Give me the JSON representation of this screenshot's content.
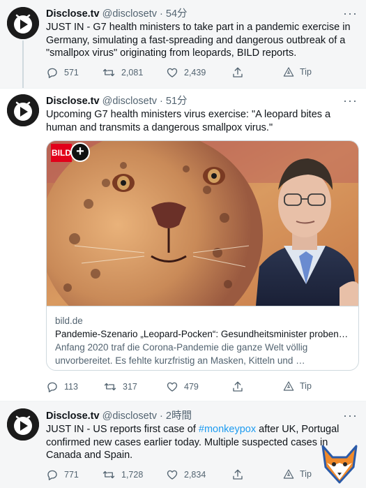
{
  "tweets": [
    {
      "name": "Disclose.tv",
      "handle": "@disclosetv",
      "time": "54分",
      "text": "JUST IN - G7 health ministers to take part in a pandemic exercise in Germany, simulating a fast-spreading and dangerous outbreak of a \"smallpox virus\" originating from leopards, BILD reports.",
      "replies": "571",
      "retweets": "2,081",
      "likes": "2,439",
      "tip": "Tip"
    },
    {
      "name": "Disclose.tv",
      "handle": "@disclosetv",
      "time": "51分",
      "text": "Upcoming G7 health ministers virus exercise: \"A leopard bites a human and transmits a dangerous smallpox virus.\"",
      "card": {
        "logo": "BILD",
        "domain": "bild.de",
        "title": "Pandemie-Szenario „Leopard-Pocken“: Gesundheitsminister proben…",
        "description": "Anfang 2020 traf die Corona-Pandemie die ganze Welt völlig unvorbereitet. Es fehlte kurzfristig an Masken, Kitteln und …"
      },
      "replies": "113",
      "retweets": "317",
      "likes": "479",
      "tip": "Tip"
    },
    {
      "name": "Disclose.tv",
      "handle": "@disclosetv",
      "time": "2時間",
      "text_before": "JUST IN - US reports first case of ",
      "hashtag": "#monkeypox",
      "text_after": " after UK, Portugal confirmed new cases earlier today. Multiple suspected cases in Canada and Spain.",
      "replies": "771",
      "retweets": "1,728",
      "likes": "2,834",
      "tip": "Tip"
    }
  ],
  "separator": " · ",
  "more_glyph": "···",
  "colors": {
    "link": "#1d9bf0",
    "muted": "#536471",
    "bild_red": "#e2001a"
  }
}
